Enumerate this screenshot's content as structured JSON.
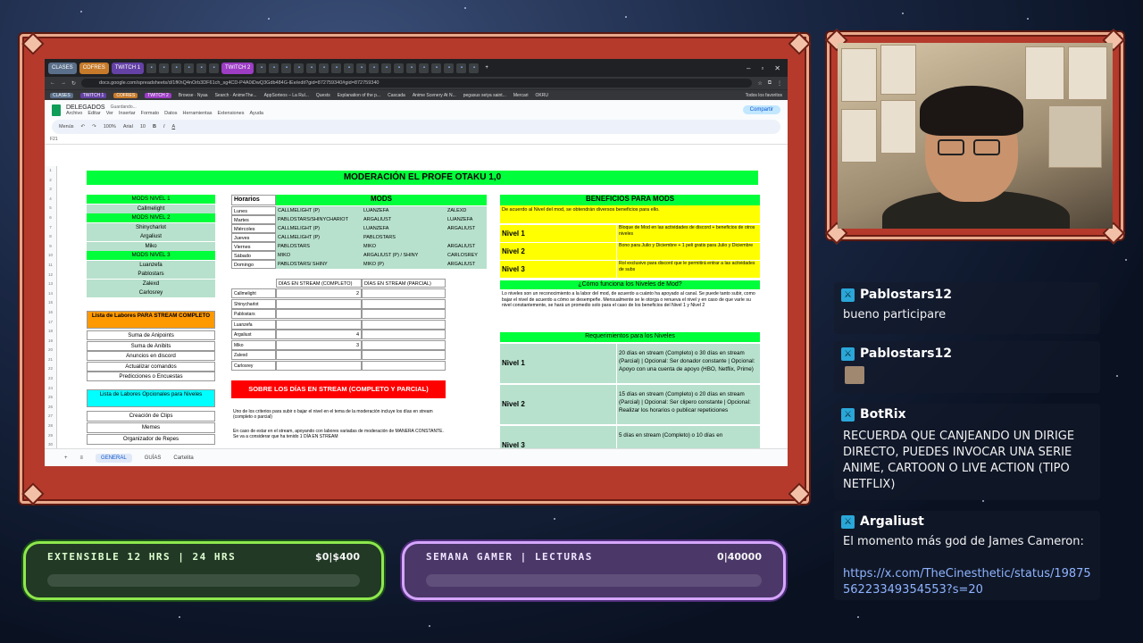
{
  "browser": {
    "tabs": [
      {
        "label": "CLASES",
        "color": "#5a6f8a"
      },
      {
        "label": "COFRES",
        "color": "#c77b2a"
      },
      {
        "label": "TWITCH 1",
        "color": "#6441a5"
      },
      {
        "label": "TWITCH 2",
        "color": "#9c3dc4"
      }
    ],
    "url": "docs.google.com/spreadsheets/d/1fKhQ4nOrb3DF61ch_sg4CD-P4A0iDwQ3Gdb484G-lEe/edit?gid=872759340#gid=872759340",
    "bookmarks": [
      "Browse · Nyaa",
      "Search · AnimeThe...",
      "AppSorteos – La Rul...",
      "Quests",
      "Explanation of the p...",
      "Cascada",
      "Anime Scenery At N...",
      "pegasus seiya saint...",
      "Mercari",
      "OKRU",
      "Todos los favoritos"
    ],
    "bookmark_pills": [
      {
        "label": "CLASES",
        "color": "#5a6f8a"
      },
      {
        "label": "TWITCH 1",
        "color": "#6441a5"
      },
      {
        "label": "COFRES",
        "color": "#c77b2a"
      },
      {
        "label": "TWITCH 2",
        "color": "#9c3dc4"
      }
    ]
  },
  "sheets": {
    "doc_title": "DELEGADOS",
    "saving": "Guardando...",
    "menus": [
      "Archivo",
      "Editar",
      "Ver",
      "Insertar",
      "Formato",
      "Datos",
      "Herramientas",
      "Extensiones",
      "Ayuda"
    ],
    "share": "Compartir",
    "toolbar": {
      "menus": "Menús",
      "zoom": "100%",
      "font": "Arial",
      "size": "10"
    },
    "cell_ref": "F21",
    "title": "MODERACIÓN EL PROFE OTAKU 1,0",
    "levels": [
      "MODS NIVEL 1",
      "Callmelight",
      "MODS NIVEL 2",
      "Shinycharlot",
      "Argaliust",
      "Miko",
      "MODS NIVEL 3",
      "Luanzefa",
      "Pablostars",
      "Zalexd",
      "Carlosrey"
    ],
    "schedule": {
      "header_left": "Horarios",
      "header_right": "MODS",
      "rows": [
        [
          "Lunes",
          "CALLMELIGHT (P)",
          "LUANZEFA",
          "ZALEXD"
        ],
        [
          "Martes",
          "PABLOSTARS/SHINYCHARIOT",
          "ARGALIUST",
          "LUANZEFA"
        ],
        [
          "Miércoles",
          "CALLMELIGHT (P)",
          "LUANZEFA",
          "ARGALIUST"
        ],
        [
          "Jueves",
          "CALLMELIGHT (P)",
          "PABLOSTARS",
          ""
        ],
        [
          "Viernes",
          "PABLOSTARS",
          "MIKO",
          "ARGALIUST"
        ],
        [
          "Sábado",
          "MIKO",
          "ARGALIUST (P) / SHINY",
          "CARLOSREY"
        ],
        [
          "Domingo",
          "PABLOSTARS/ SHINY",
          "MIKO (P)",
          "ARGALIUST"
        ]
      ]
    },
    "days_table": {
      "h1": "DÍAS EN STREAM (COMPLETO)",
      "h2": "DÍAS EN STREAM (PARCIAL)",
      "rows": [
        [
          "Callmelight",
          "2"
        ],
        [
          "Shinycharlot",
          ""
        ],
        [
          "Pablostars",
          ""
        ],
        [
          "Luanzefa",
          ""
        ],
        [
          "Argaliust",
          "4"
        ],
        [
          "Miko",
          "3"
        ],
        [
          "Zalexd",
          ""
        ],
        [
          "Carlosrey",
          ""
        ]
      ]
    },
    "labores": {
      "title": "Lista de Labores PARA STREAM COMPLETO",
      "items": [
        "Suma de Anipoints",
        "Suma de Anibits",
        "Anuncios en discord",
        "Actualizar comandos",
        "Predicciones o Encuestas"
      ]
    },
    "opcionales": {
      "title": "Lista de Labores Opcionales para Niveles",
      "items": [
        "Creación de Clips",
        "Memes",
        "Organizador de Repes"
      ]
    },
    "red_banner": "SOBRE LOS DÍAS EN STREAM (COMPLETO Y PARCIAL)",
    "red_text1": "Uno de los criterios para subir o bajar el nivel en el tema de la moderación incluye los días en stream (completo o parcial)",
    "red_text2": "En caso de estar en el stream, apoyando con labores variadas de moderación de MANERA CONSTANTE. Se va a considerar que ha tenido 1 DÍA EN STREAM",
    "benefits": {
      "title": "BENEFICIOS PARA MODS",
      "intro": "De acuerdo al Nivel del mod, se obtendrán diversos beneficios para ello.",
      "rows": [
        [
          "Nivel 1",
          "Bloque de Mod en las actividades de discord + beneficios de otros niveles"
        ],
        [
          "Nivel 2",
          "Bono para Julio y Diciembre + 1 peli gratis para Julio y Diciembre"
        ],
        [
          "Nivel 3",
          "Rol exclusivo para discord que le permitirá entrar a las actividades de subs"
        ]
      ],
      "how_title": "¿Cómo funciona los Niveles de Mod?",
      "how_text": "Lo niveles son un reconocimiento a la labor del mod, de acuerdo a cuánto ha apoyado al canal. Se puede tanto subir, como bajar el nivel de acuerdo a cómo se desempeñe. Mensualmente se le otorga o renueva el nivel y en caso de que varíe su nivel constantemente, se hará un promedio solo para el caso de los beneficios del Nivel 1 y Nivel 2",
      "req_title": "Requerimientos para los Niveles",
      "req": [
        [
          "Nivel 1",
          "20 días en stream (Completo) o 30 días en stream (Parcial) | Opcional: Ser donador constante | Opcional: Apoyo con una cuenta de apoyo (HBO, Netflix, Prime)"
        ],
        [
          "Nivel 2",
          "15 días en stream (Completo) o 20 días en stream (Parcial) | Opcional: Ser clipero constante | Opcional: Realizar los horarios o publicar repeticiones"
        ],
        [
          "Nivel 3",
          "5 días en stream (Completo) o 10 días en"
        ]
      ]
    },
    "sheet_tabs": [
      "GENERAL",
      "GUÍAS",
      "Cartelita"
    ]
  },
  "chat": [
    {
      "user": "Pablostars12",
      "text": "bueno participare"
    },
    {
      "user": "Pablostars12",
      "text": ""
    },
    {
      "user": "BotRix",
      "text": "RECUERDA QUE CANJEANDO UN DIRIGE DIRECTO, PUEDES INVOCAR UNA SERIE ANIME, CARTOON O LIVE ACTION (TIPO NETFLIX)"
    },
    {
      "user": "Argaliust",
      "text": "El momento más god de James Cameron:",
      "link": "https://x.com/TheCinesthetic/status/1987556223349354553?s=20"
    }
  ],
  "goals": [
    {
      "label": "EXTENSIBLE 12 HRS | 24 HRS",
      "amount": "$0|$400",
      "progress": 0.0
    },
    {
      "label": "SEMANA GAMER | LECTURAS",
      "amount": "0|40000",
      "progress": 0.0
    }
  ]
}
